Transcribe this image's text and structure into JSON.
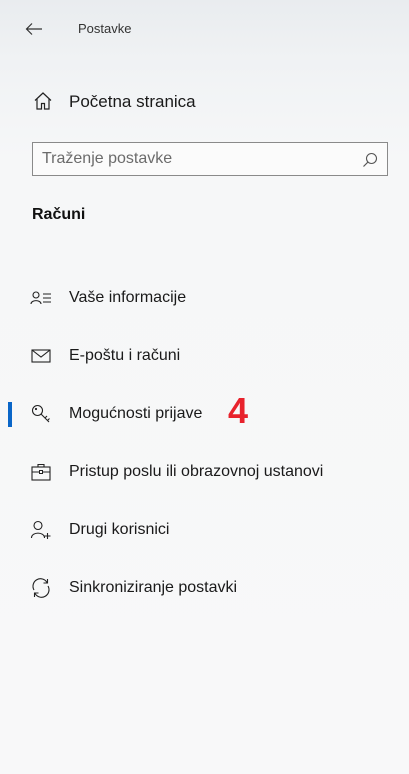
{
  "header": {
    "app_title": "Postavke",
    "back_icon": "back-arrow-icon"
  },
  "home": {
    "label": "Početna stranica",
    "icon": "home-icon"
  },
  "search": {
    "placeholder": "Traženje postavke",
    "value": "",
    "icon": "search-icon"
  },
  "section": {
    "title": "Računi"
  },
  "nav": {
    "items": [
      {
        "label": "Vaše informacije",
        "icon": "contact-info-icon",
        "selected": false
      },
      {
        "label": "E-poštu i računi",
        "icon": "mail-icon",
        "selected": false
      },
      {
        "label": "Mogućnosti prijave",
        "icon": "key-icon",
        "selected": true,
        "annotation": "4"
      },
      {
        "label": "Pristup poslu ili obrazovnoj ustanovi",
        "icon": "briefcase-icon",
        "selected": false
      },
      {
        "label": "Drugi korisnici",
        "icon": "add-person-icon",
        "selected": false
      },
      {
        "label": "Sinkroniziranje postavki",
        "icon": "sync-icon",
        "selected": false
      }
    ]
  },
  "colors": {
    "accent": "#0a66c8",
    "annotation": "#e8222c"
  }
}
